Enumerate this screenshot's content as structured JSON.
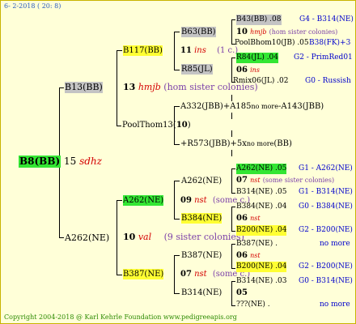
{
  "date": "6- 2-2018 ( 20: 8)",
  "footer": "Copyright 2004-2018 @ Karl Kehrle Foundation   www.pedigreeapis.org",
  "root": "B8(BB)",
  "gen1": {
    "top_label": "B13(BB)",
    "top_num": "15",
    "top_name": "sdhz",
    "bottom_label": "A262(NE)"
  },
  "gen2": {
    "top_num": "13",
    "top_name": "hmjb",
    "top_note": "(hom sister colonies)",
    "b117": "B117(BB)",
    "b117_num": "11",
    "b117_name": "ins",
    "b117_note": "(1 c.)",
    "pool": "PoolThom13(",
    "pool_num": "10",
    "pool_close": ")",
    "bottom_num": "10",
    "bottom_name": "val",
    "bottom_note": "(9 sister colonies)",
    "a262ne": "A262(NE)",
    "a262ne_num": "09",
    "a262ne_name": "nst",
    "a262ne_note": "(some c.)",
    "b387": "B387(NE)",
    "b387_num": "07",
    "b387_name": "nst",
    "b387_note": "(some c.)"
  },
  "gen3": {
    "b63": "B63(BB)",
    "r85": "R85(JL)",
    "a332": "A332(JBB)+A185",
    "a332_more": "no more",
    "a332_tail": "-A143(JBB)",
    "r573": "+R573(JBB)+5x",
    "r573_more": "no more",
    "r573_tail": "(BB)",
    "a262": "A262(NE)",
    "b384": "B384(NE)",
    "b387": "B387(NE)",
    "b314": "B314(NE)"
  },
  "gen4": {
    "r1": "B43(BB) .08",
    "r1_right": "G4 - B314(NE)",
    "r2_num": "10",
    "r2_name": "hmjb",
    "r2_note": "(hom sister colonies)",
    "r3": "PoolBhom10(JB) .05",
    "r3_right": "B38(FK)+3",
    "r4": "R84(JL) .04",
    "r4_right": "G2 - PrimRed01",
    "r5_num": "06",
    "r5_name": "ins",
    "r6": "Rmix06(JL) .02",
    "r6_right": "G0 - Russish",
    "r7": "A262(NE) .05",
    "r7_right": "G1 - A262(NE)",
    "r8_num": "07",
    "r8_name": "nst",
    "r8_note": "(some sister colonies)",
    "r9": "B314(NE) .05",
    "r9_right": "G1 - B314(NE)",
    "r10": "B384(NE) .04",
    "r10_right": "G0 - B384(NE)",
    "r11_num": "06",
    "r11_name": "nst",
    "r12": "B200(NE) .04",
    "r12_right": "G2 - B200(NE)",
    "r13": "B387(NE) .",
    "r13_right": "no more",
    "r14_num": "06",
    "r14_name": "nst",
    "r15": "B200(NE) .04",
    "r15_right": "G2 - B200(NE)",
    "r16": "B314(NE) .03",
    "r16_right": "G0 - B314(NE)",
    "r17_num": "05",
    "r18": "???(NE) .",
    "r18_right": "no more"
  }
}
